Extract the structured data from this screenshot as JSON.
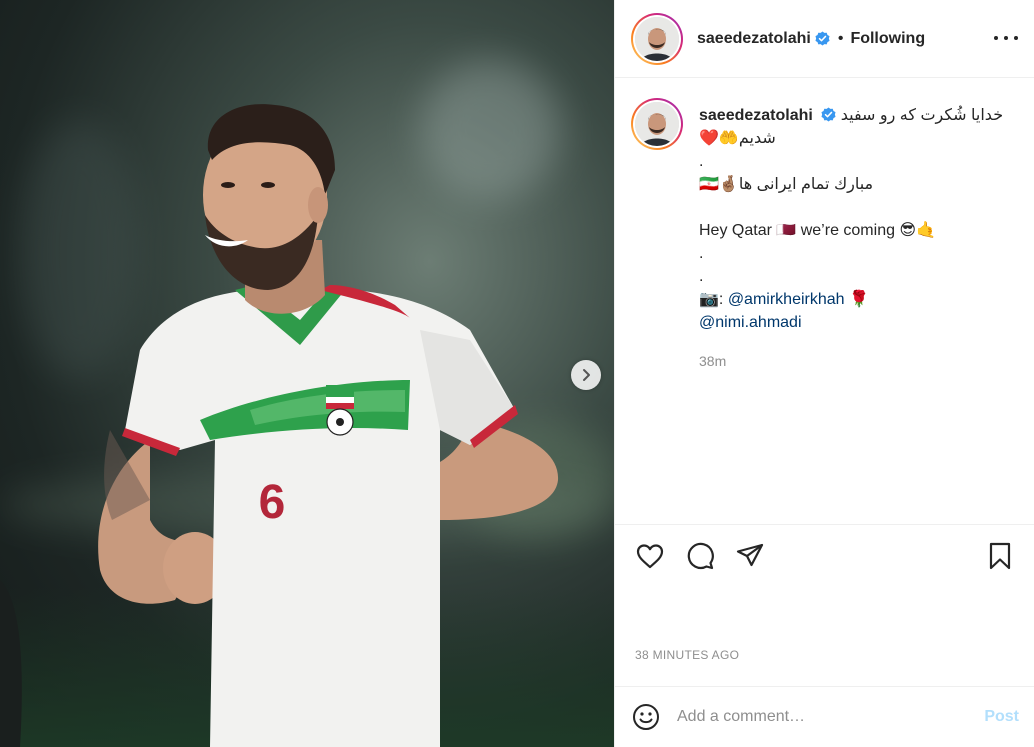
{
  "post": {
    "image_alt": "",
    "jersey_number": "6"
  },
  "header": {
    "username": "saeedezatolahi",
    "dot": "•",
    "follow_status": "Following"
  },
  "caption": {
    "username": "saeedezatolahi",
    "line1": "خدایا شُکرت که رو سفید",
    "line2": "شدیم🤲❤️",
    "line3": ".",
    "line4": "مبارك تمام ایرانی ها🤞🏽🇮🇷",
    "line5": "",
    "line6": "Hey Qatar 🇶🇦 we’re coming 😎🤙",
    "line7": ".",
    "line8": ".",
    "credit_prefix": "📷: ",
    "mention1": "@amirkheirkhah",
    "credit_suffix": " 🌹",
    "mention2": "@nimi.ahmadi",
    "relative_time": "38m"
  },
  "actions": {
    "like_icon": "heart-icon",
    "comment_icon": "comment-icon",
    "share_icon": "paper-plane-icon",
    "save_icon": "bookmark-icon"
  },
  "meta": {
    "post_time": "38 MINUTES AGO"
  },
  "comment": {
    "placeholder": "Add a comment…",
    "post_label": "Post"
  },
  "colors": {
    "link": "#00376b",
    "verified": "#3897f0",
    "post_disabled": "#b2dffc",
    "muted": "#8e8e8e"
  }
}
